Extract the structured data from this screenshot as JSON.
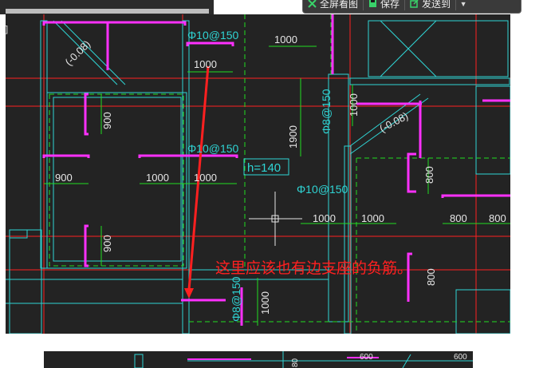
{
  "toolbar": {
    "fullscreen_label": "全屏看图",
    "save_label": "保存",
    "send_label": "发送到",
    "colors": {
      "bg": "#3a3a3a",
      "text": "#eeeeee"
    }
  },
  "drawing": {
    "left_bracket": "]",
    "rebar_labels": [
      "Φ10@150",
      "Φ10@150",
      "Φ10@150",
      "Φ8@150",
      "Φ8@150"
    ],
    "dimensions": [
      "1000",
      "1000",
      "900",
      "900",
      "1000",
      "1000",
      "1900",
      "1000",
      "800",
      "1000",
      "1000",
      "800",
      "800",
      "800",
      "1000"
    ],
    "slab_thickness": "h=140",
    "slope_labels": [
      "(-0.08)",
      "(-0.08)"
    ],
    "annotation": "这里应该也有边支座的负筋。",
    "colors": {
      "background": "#232323",
      "cyan": "#2fd4d4",
      "magenta": "#ff30ff",
      "red": "#ff2020",
      "green": "#22dd22",
      "white": "#e6e6e6",
      "yellow_green": "#b8e000"
    }
  },
  "bottom_strip": {
    "labels": [
      "600",
      "600",
      "80"
    ]
  }
}
